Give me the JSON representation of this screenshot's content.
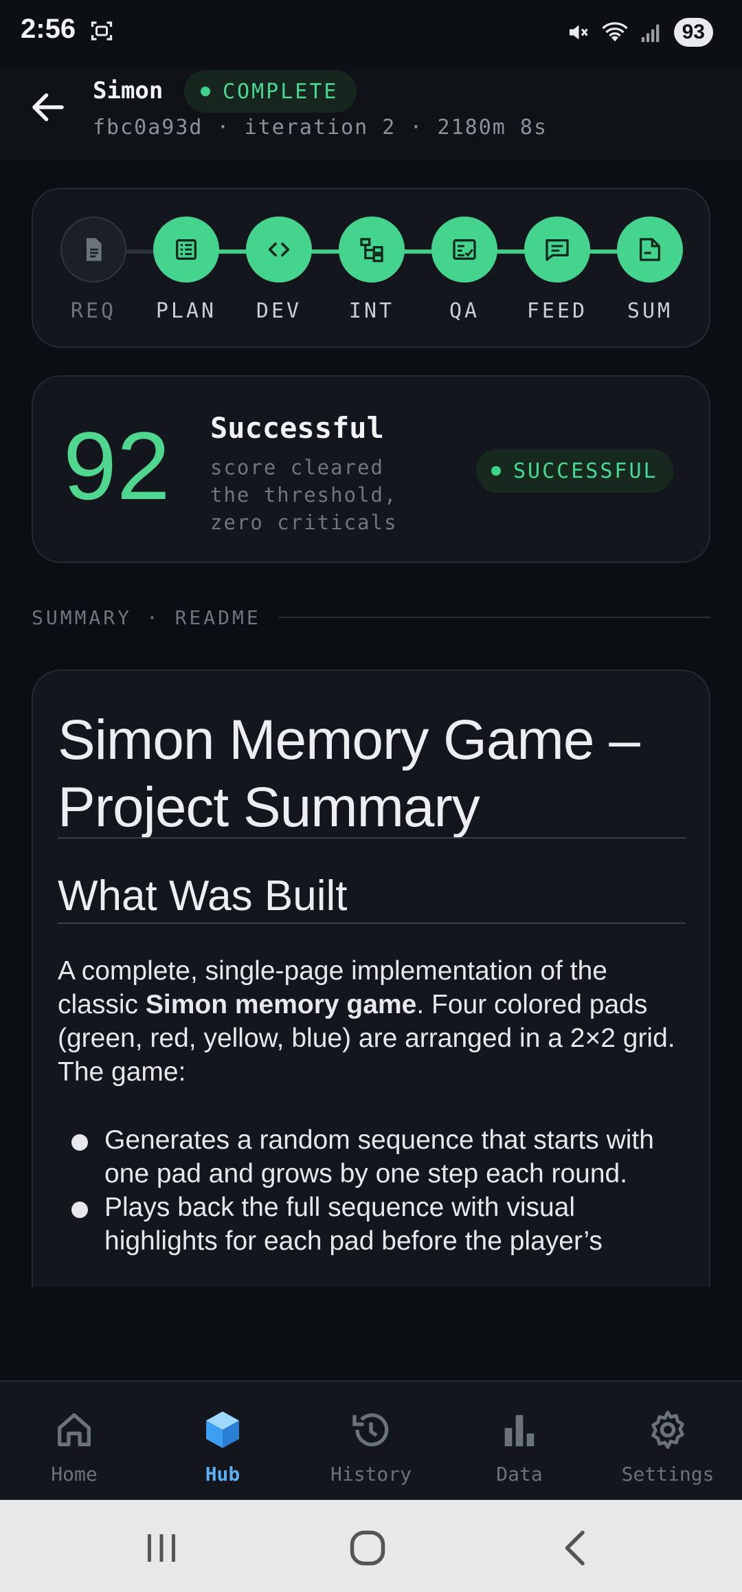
{
  "status_bar": {
    "time": "2:56",
    "battery": "93",
    "icons": [
      "screenshot-icon",
      "mute-icon",
      "wifi-icon",
      "signal-icon",
      "battery-icon"
    ]
  },
  "header": {
    "title": "Simon",
    "status_badge": "COMPLETE",
    "subtitle": "fbc0a93d · iteration 2 · 2180m 8s"
  },
  "pipeline": {
    "stages": [
      {
        "label": "REQ",
        "state": "inactive",
        "icon": "document-icon"
      },
      {
        "label": "PLAN",
        "state": "complete",
        "icon": "list-icon"
      },
      {
        "label": "DEV",
        "state": "complete",
        "icon": "code-icon"
      },
      {
        "label": "INT",
        "state": "complete",
        "icon": "integration-icon"
      },
      {
        "label": "QA",
        "state": "complete",
        "icon": "checklist-icon"
      },
      {
        "label": "FEED",
        "state": "complete",
        "icon": "chat-icon"
      },
      {
        "label": "SUM",
        "state": "complete",
        "icon": "summary-icon"
      }
    ]
  },
  "score_card": {
    "score": "92",
    "verdict": "Successful",
    "description": "score cleared the threshold, zero criticals",
    "badge": "SUCCESSFUL"
  },
  "section": {
    "label": "SUMMARY · README"
  },
  "readme": {
    "title": "Simon Memory Game – Project Summary",
    "heading": "What Was Built",
    "para_before": "A complete, single-page implementation of the classic ",
    "para_bold": "Simon memory game",
    "para_after": ". Four colored pads (green, red, yellow, blue) are arranged in a 2×2 grid. The game:",
    "bullets": [
      "Generates a random sequence that starts with one pad and grows by one step each round.",
      "Plays back the full sequence with visual highlights for each pad before the player’s"
    ]
  },
  "bottom_nav": {
    "items": [
      {
        "label": "Home",
        "icon": "home-icon",
        "active": false
      },
      {
        "label": "Hub",
        "icon": "cube-icon",
        "active": true
      },
      {
        "label": "History",
        "icon": "history-icon",
        "active": false
      },
      {
        "label": "Data",
        "icon": "bar-chart-icon",
        "active": false
      },
      {
        "label": "Settings",
        "icon": "gear-icon",
        "active": false
      }
    ]
  },
  "colors": {
    "accent_green": "#44d48e",
    "accent_blue": "#5ab0f5",
    "background": "#0b0e12",
    "card": "#13171d"
  }
}
